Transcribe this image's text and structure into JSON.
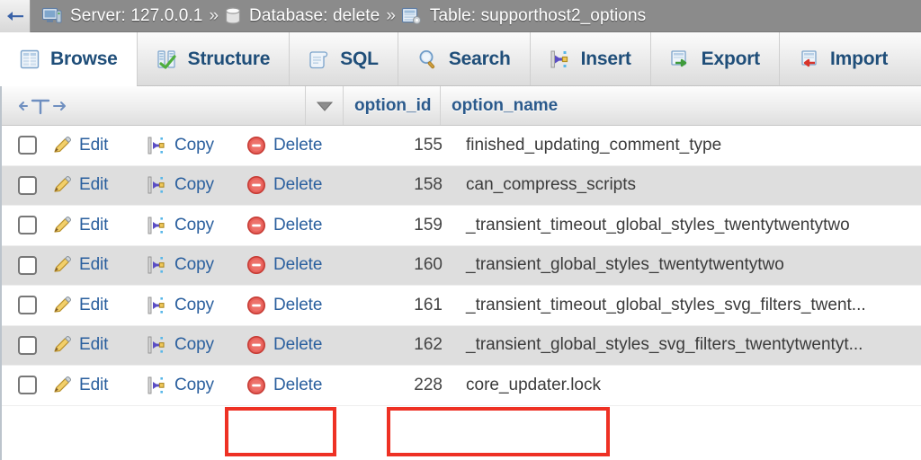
{
  "breadcrumb": {
    "back_icon": "back-arrow-icon",
    "items": [
      {
        "icon": "server-icon",
        "label": "Server: 127.0.0.1"
      },
      {
        "icon": "database-icon",
        "label": "Database: delete"
      },
      {
        "icon": "table-icon",
        "label": "Table: supporthost2_options"
      }
    ],
    "separator": "»"
  },
  "tabs": [
    {
      "label": "Browse",
      "icon": "browse-icon",
      "active": true
    },
    {
      "label": "Structure",
      "icon": "structure-icon",
      "active": false
    },
    {
      "label": "SQL",
      "icon": "sql-icon",
      "active": false
    },
    {
      "label": "Search",
      "icon": "search-icon",
      "active": false
    },
    {
      "label": "Insert",
      "icon": "insert-icon",
      "active": false
    },
    {
      "label": "Export",
      "icon": "export-icon",
      "active": false
    },
    {
      "label": "Import",
      "icon": "import-icon",
      "active": false
    }
  ],
  "table": {
    "nav_label": "←T→",
    "sort_caret": "▼",
    "columns": [
      "option_id",
      "option_name"
    ],
    "actions": {
      "edit": "Edit",
      "copy": "Copy",
      "delete": "Delete"
    },
    "rows": [
      {
        "option_id": "155",
        "option_name": "finished_updating_comment_type"
      },
      {
        "option_id": "158",
        "option_name": "can_compress_scripts"
      },
      {
        "option_id": "159",
        "option_name": "_transient_timeout_global_styles_twentytwentytwo"
      },
      {
        "option_id": "160",
        "option_name": "_transient_global_styles_twentytwentytwo"
      },
      {
        "option_id": "161",
        "option_name": "_transient_timeout_global_styles_svg_filters_twent..."
      },
      {
        "option_id": "162",
        "option_name": "_transient_global_styles_svg_filters_twentytwentyt..."
      },
      {
        "option_id": "228",
        "option_name": "core_updater.lock"
      }
    ]
  },
  "annotations": {
    "color": "#ee3124",
    "boxes": [
      {
        "name": "delete-link-highlight",
        "target": "Delete"
      },
      {
        "name": "row-value-highlight",
        "target": "228 core_updater.lock"
      }
    ]
  },
  "colors": {
    "header_bar": "#8b8b8b",
    "tab_text": "#1f4e79",
    "link": "#2a5f9e",
    "row_alt": "#dedede",
    "annotation_red": "#ee3124"
  }
}
